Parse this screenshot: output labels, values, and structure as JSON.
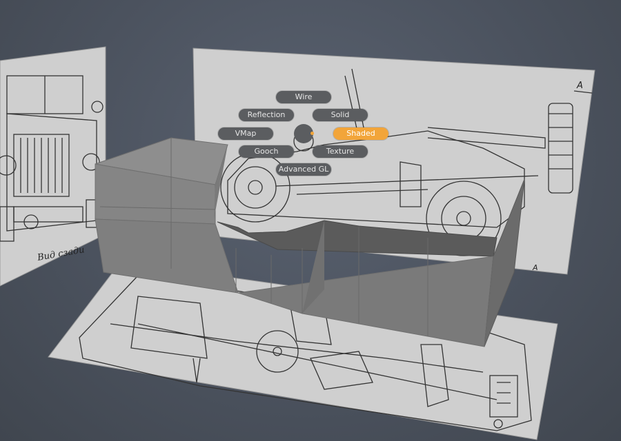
{
  "viewport": {
    "background": "#4b525e"
  },
  "pie_menu": {
    "items": [
      {
        "key": "wire",
        "label": "Wire"
      },
      {
        "key": "reflection",
        "label": "Reflection"
      },
      {
        "key": "solid",
        "label": "Solid"
      },
      {
        "key": "vmap",
        "label": "VMap"
      },
      {
        "key": "shaded",
        "label": "Shaded",
        "active": true
      },
      {
        "key": "gooch",
        "label": "Gooch"
      },
      {
        "key": "texture",
        "label": "Texture"
      },
      {
        "key": "advanced_gl",
        "label": "Advanced GL"
      }
    ],
    "active_color": "#f2a53a",
    "button_color": "#5b5d60"
  },
  "blueprints": {
    "front_caption": "Вид сзади",
    "side_marker": "A",
    "side_marker_2": "A"
  }
}
